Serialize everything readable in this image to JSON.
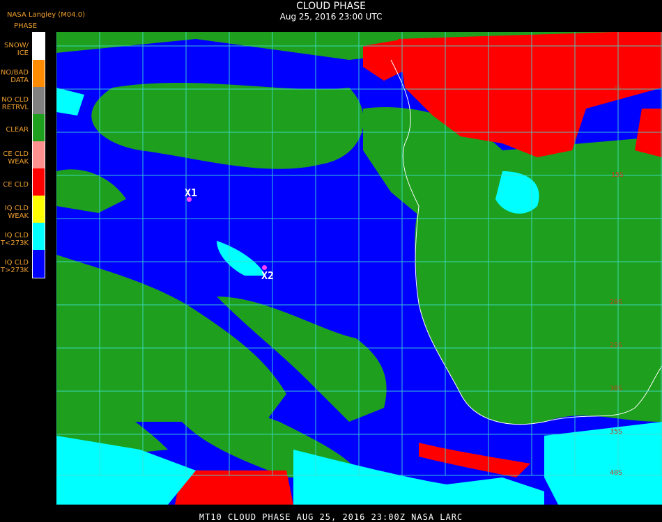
{
  "header": {
    "provider": "NASA Langley (M04.0)",
    "title": "CLOUD PHASE",
    "subtitle": "Aug 25, 2016 23:00 UTC"
  },
  "legend": {
    "heading": "PHASE",
    "items": [
      {
        "l1": "SNOW/",
        "l2": "ICE",
        "color": "#ffffff"
      },
      {
        "l1": "NO/BAD",
        "l2": "DATA",
        "color": "#ff8c00"
      },
      {
        "l1": "NO CLD",
        "l2": "RETRVL",
        "color": "#808080"
      },
      {
        "l1": "CLEAR",
        "l2": "",
        "color": "#1ea01e"
      },
      {
        "l1": "CE CLD",
        "l2": "WEAK",
        "color": "#ff9090"
      },
      {
        "l1": "CE CLD",
        "l2": "",
        "color": "#ff0000"
      },
      {
        "l1": "IQ CLD",
        "l2": "WEAK",
        "color": "#ffff00"
      },
      {
        "l1": "IQ CLD",
        "l2": "T<273K",
        "color": "#00ffff"
      },
      {
        "l1": "IQ CLD",
        "l2": "T>273K",
        "color": "#0000ff"
      }
    ]
  },
  "markers": [
    {
      "label": "X1"
    },
    {
      "label": "X2"
    }
  ],
  "lat_labels": [
    "5S",
    "15S",
    "20S",
    "25S",
    "30S",
    "35S",
    "40S"
  ],
  "footer": "MT10  CLOUD PHASE   AUG 25, 2016 23:00Z   NASA LARC"
}
